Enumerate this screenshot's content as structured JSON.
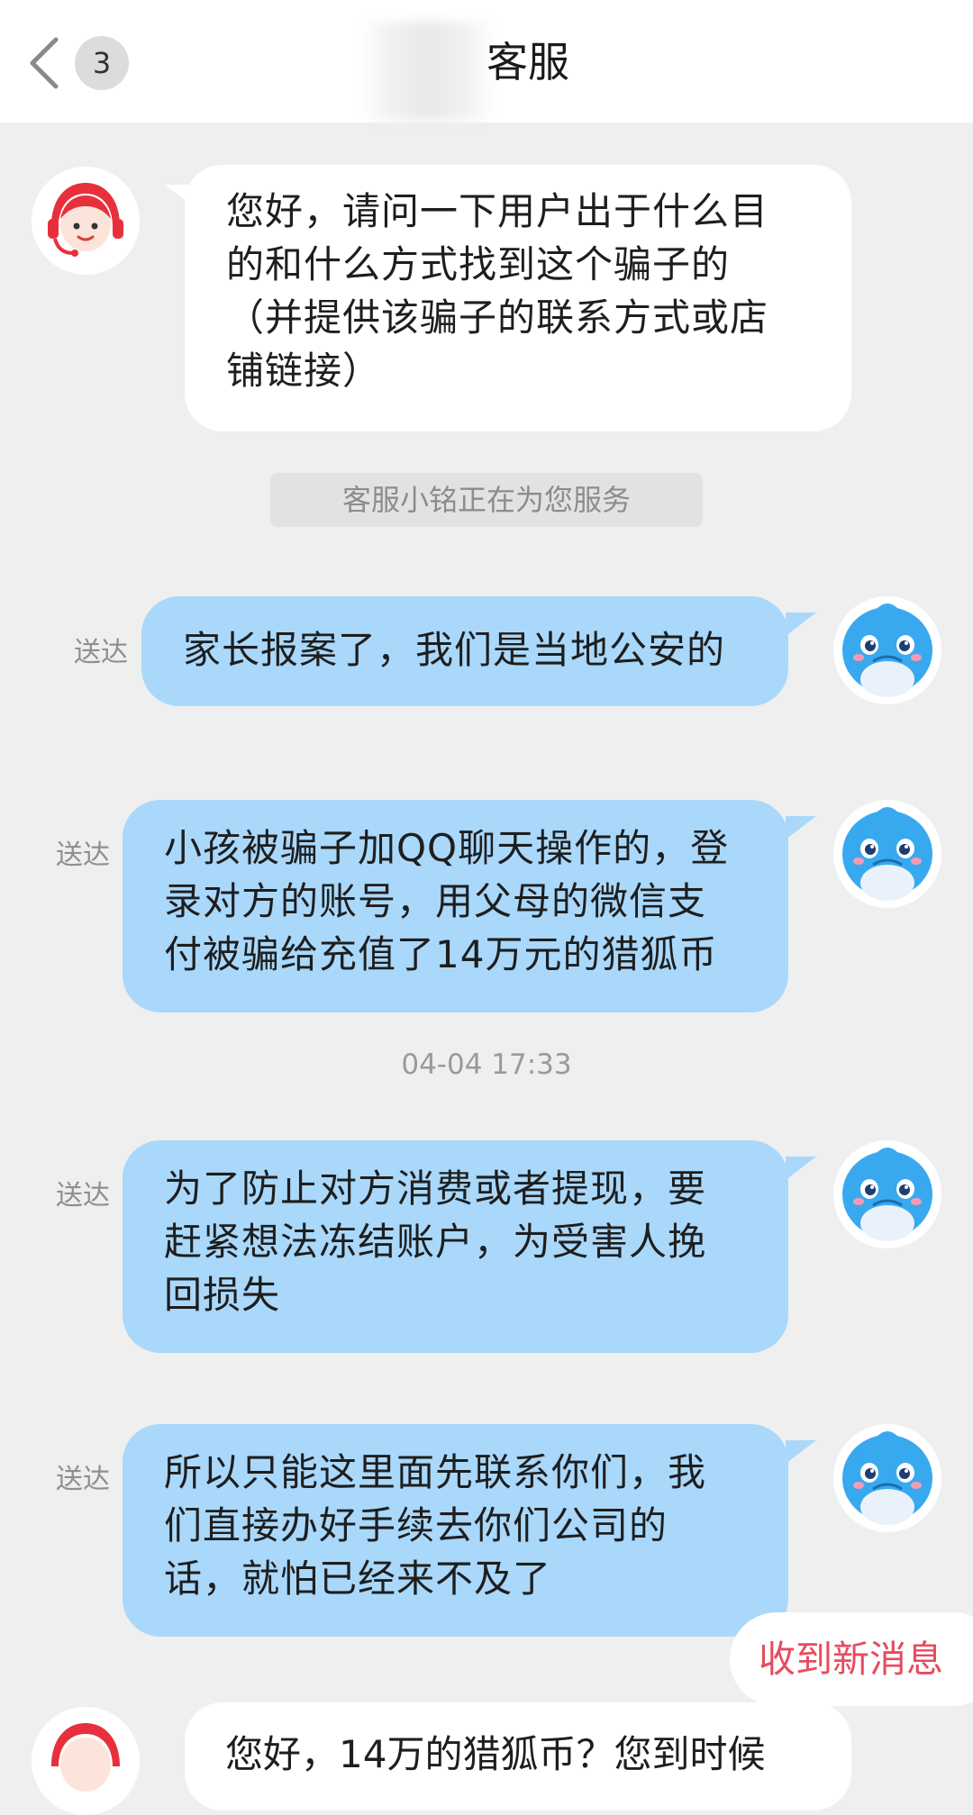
{
  "header": {
    "back_icon": "chevron-left-icon",
    "unread_count": "3",
    "title": "客服"
  },
  "messages": [
    {
      "sender": "agent",
      "avatar": "customer-service-headset-avatar",
      "lines": [
        "您好，请问一下用户出于什么目",
        "的和什么方式找到这个骗子的",
        "（并提供该骗子的联系方式或店",
        "铺链接）"
      ]
    },
    {
      "sender": "user",
      "status": "送达",
      "avatar": "blue-dolphin-avatar",
      "lines": [
        "家长报案了，我们是当地公安的"
      ]
    },
    {
      "sender": "user",
      "status": "送达",
      "avatar": "blue-dolphin-avatar",
      "lines": [
        "小孩被骗子加QQ聊天操作的，登",
        "录对方的账号，用父母的微信支",
        "付被骗给充值了14万元的猎狐币"
      ]
    },
    {
      "sender": "user",
      "status": "送达",
      "avatar": "blue-dolphin-avatar",
      "lines": [
        "为了防止对方消费或者提现，要",
        "赶紧想法冻结账户，为受害人挽",
        "回损失"
      ]
    },
    {
      "sender": "user",
      "status": "送达",
      "avatar": "blue-dolphin-avatar",
      "lines": [
        "所以只能这里面先联系你们，我",
        "们直接办好手续去你们公司的",
        "话，就怕已经来不及了"
      ]
    }
  ],
  "system_notice": "客服小铭正在为您服务",
  "timestamp": "04-04 17:33",
  "new_message_pill": "收到新消息",
  "partial_next_message": "您好，14万的猎狐币？您到时候",
  "colors": {
    "user_bubble": "#a9d8fb",
    "agent_bubble": "#ffffff",
    "background": "#efefef",
    "accent_red": "#e74b5f",
    "avatar_red": "#e8303d",
    "dolphin_blue": "#39a9ef"
  }
}
